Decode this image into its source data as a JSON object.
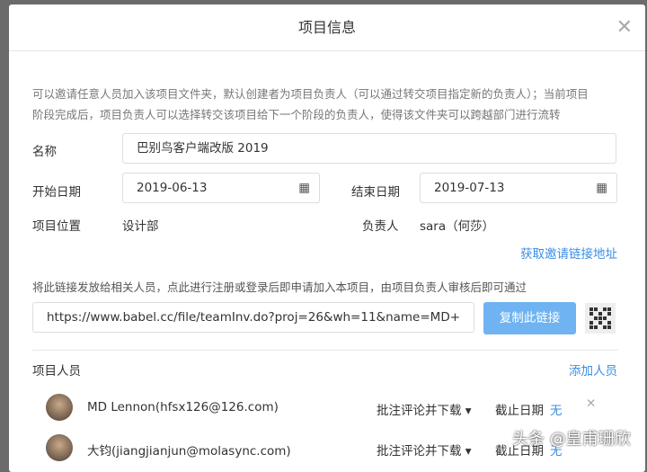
{
  "dialog": {
    "title": "项目信息",
    "description": "可以邀请任意人员加入该项目文件夹，默认创建者为项目负责人（可以通过转交项目指定新的负责人）；当前项目阶段完成后，项目负责人可以选择转交该项目给下一个阶段的负责人，使得该文件夹可以跨越部门进行流转"
  },
  "form": {
    "name_label": "名称",
    "name_value": "巴别鸟客户端改版 2019",
    "start_label": "开始日期",
    "start_value": "2019-06-13",
    "end_label": "结束日期",
    "end_value": "2019-07-13",
    "location_label": "项目位置",
    "location_value": "设计部",
    "owner_label": "负责人",
    "owner_value": "sara（何莎）"
  },
  "invite": {
    "get_link": "获取邀请链接地址",
    "hint": "将此链接发放给相关人员，点此进行注册或登录后即申请加入本项目，由项目负责人审核后即可通过",
    "url": "https://www.babel.cc/file/teamInv.do?proj=26&wh=11&name=MD+",
    "copy_label": "复制此链接"
  },
  "members": {
    "title": "项目人员",
    "add_label": "添加人员",
    "items": [
      {
        "name": "MD Lennon(hfsx126@126.com)",
        "permission": "批注评论并下载",
        "deadline_label": "截止日期",
        "deadline": "无"
      },
      {
        "name": "大钧(jiangjianjun@molasync.com)",
        "permission": "批注评论并下载",
        "deadline_label": "截止日期",
        "deadline": "无"
      }
    ]
  },
  "watermark": "头条 @皇甫珊欣"
}
